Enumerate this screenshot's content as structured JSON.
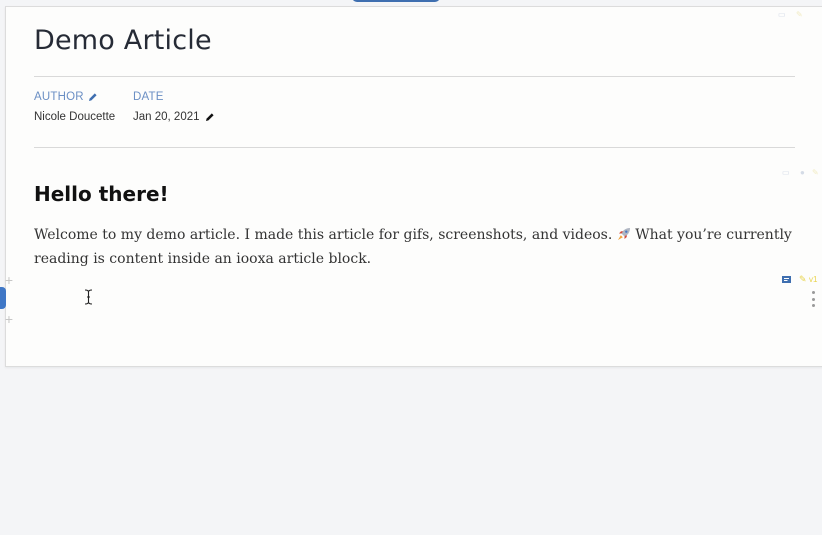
{
  "article": {
    "title": "Demo Article",
    "author_label": "AUTHOR",
    "author_value": "Nicole Doucette",
    "date_label": "DATE",
    "date_value": "Jan 20, 2021"
  },
  "block": {
    "heading": "Hello there!",
    "paragraph_before_emoji": "Welcome to my demo article. I made this article for gifs, screenshots, and videos.",
    "emoji": "rocket",
    "paragraph_after_emoji": "What you’re currently reading is content inside an iooxa article block."
  },
  "toolbar": {
    "version_badge": "v1"
  },
  "colors": {
    "accent": "#3f77c6",
    "label": "#6b8fc4",
    "badge": "#e8d44d"
  },
  "icons": [
    "comment-icon",
    "pencil-icon",
    "check-circle-icon",
    "plus-icon",
    "more-vertical-icon",
    "text-cursor-icon",
    "rocket-icon"
  ]
}
